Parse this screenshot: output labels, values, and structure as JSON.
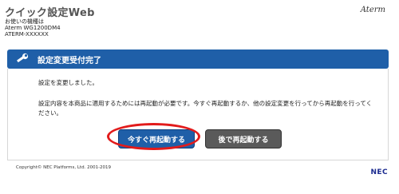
{
  "header": {
    "title": "クイック設定Web",
    "device_lines": [
      "お使いの機種は",
      "Aterm WG1200DM4",
      "ATERM-XXXXXX"
    ],
    "brand": "Aterm"
  },
  "banner": {
    "icon": "wrench-icon",
    "title": "設定変更受付完了",
    "color": "#1f5fa8"
  },
  "content": {
    "message_1": "設定を変更しました。",
    "message_2": "設定内容を本商品に適用するためには再起動が必要です。今すぐ再起動するか、他の設定変更を行ってから再起動を行ってください。"
  },
  "buttons": {
    "restart_now": "今すぐ再起動する",
    "restart_later": "後で再起動する"
  },
  "footer": {
    "copyright": "Copyright© NEC Platforms, Ltd. 2001-2019",
    "logo": "NEC"
  }
}
